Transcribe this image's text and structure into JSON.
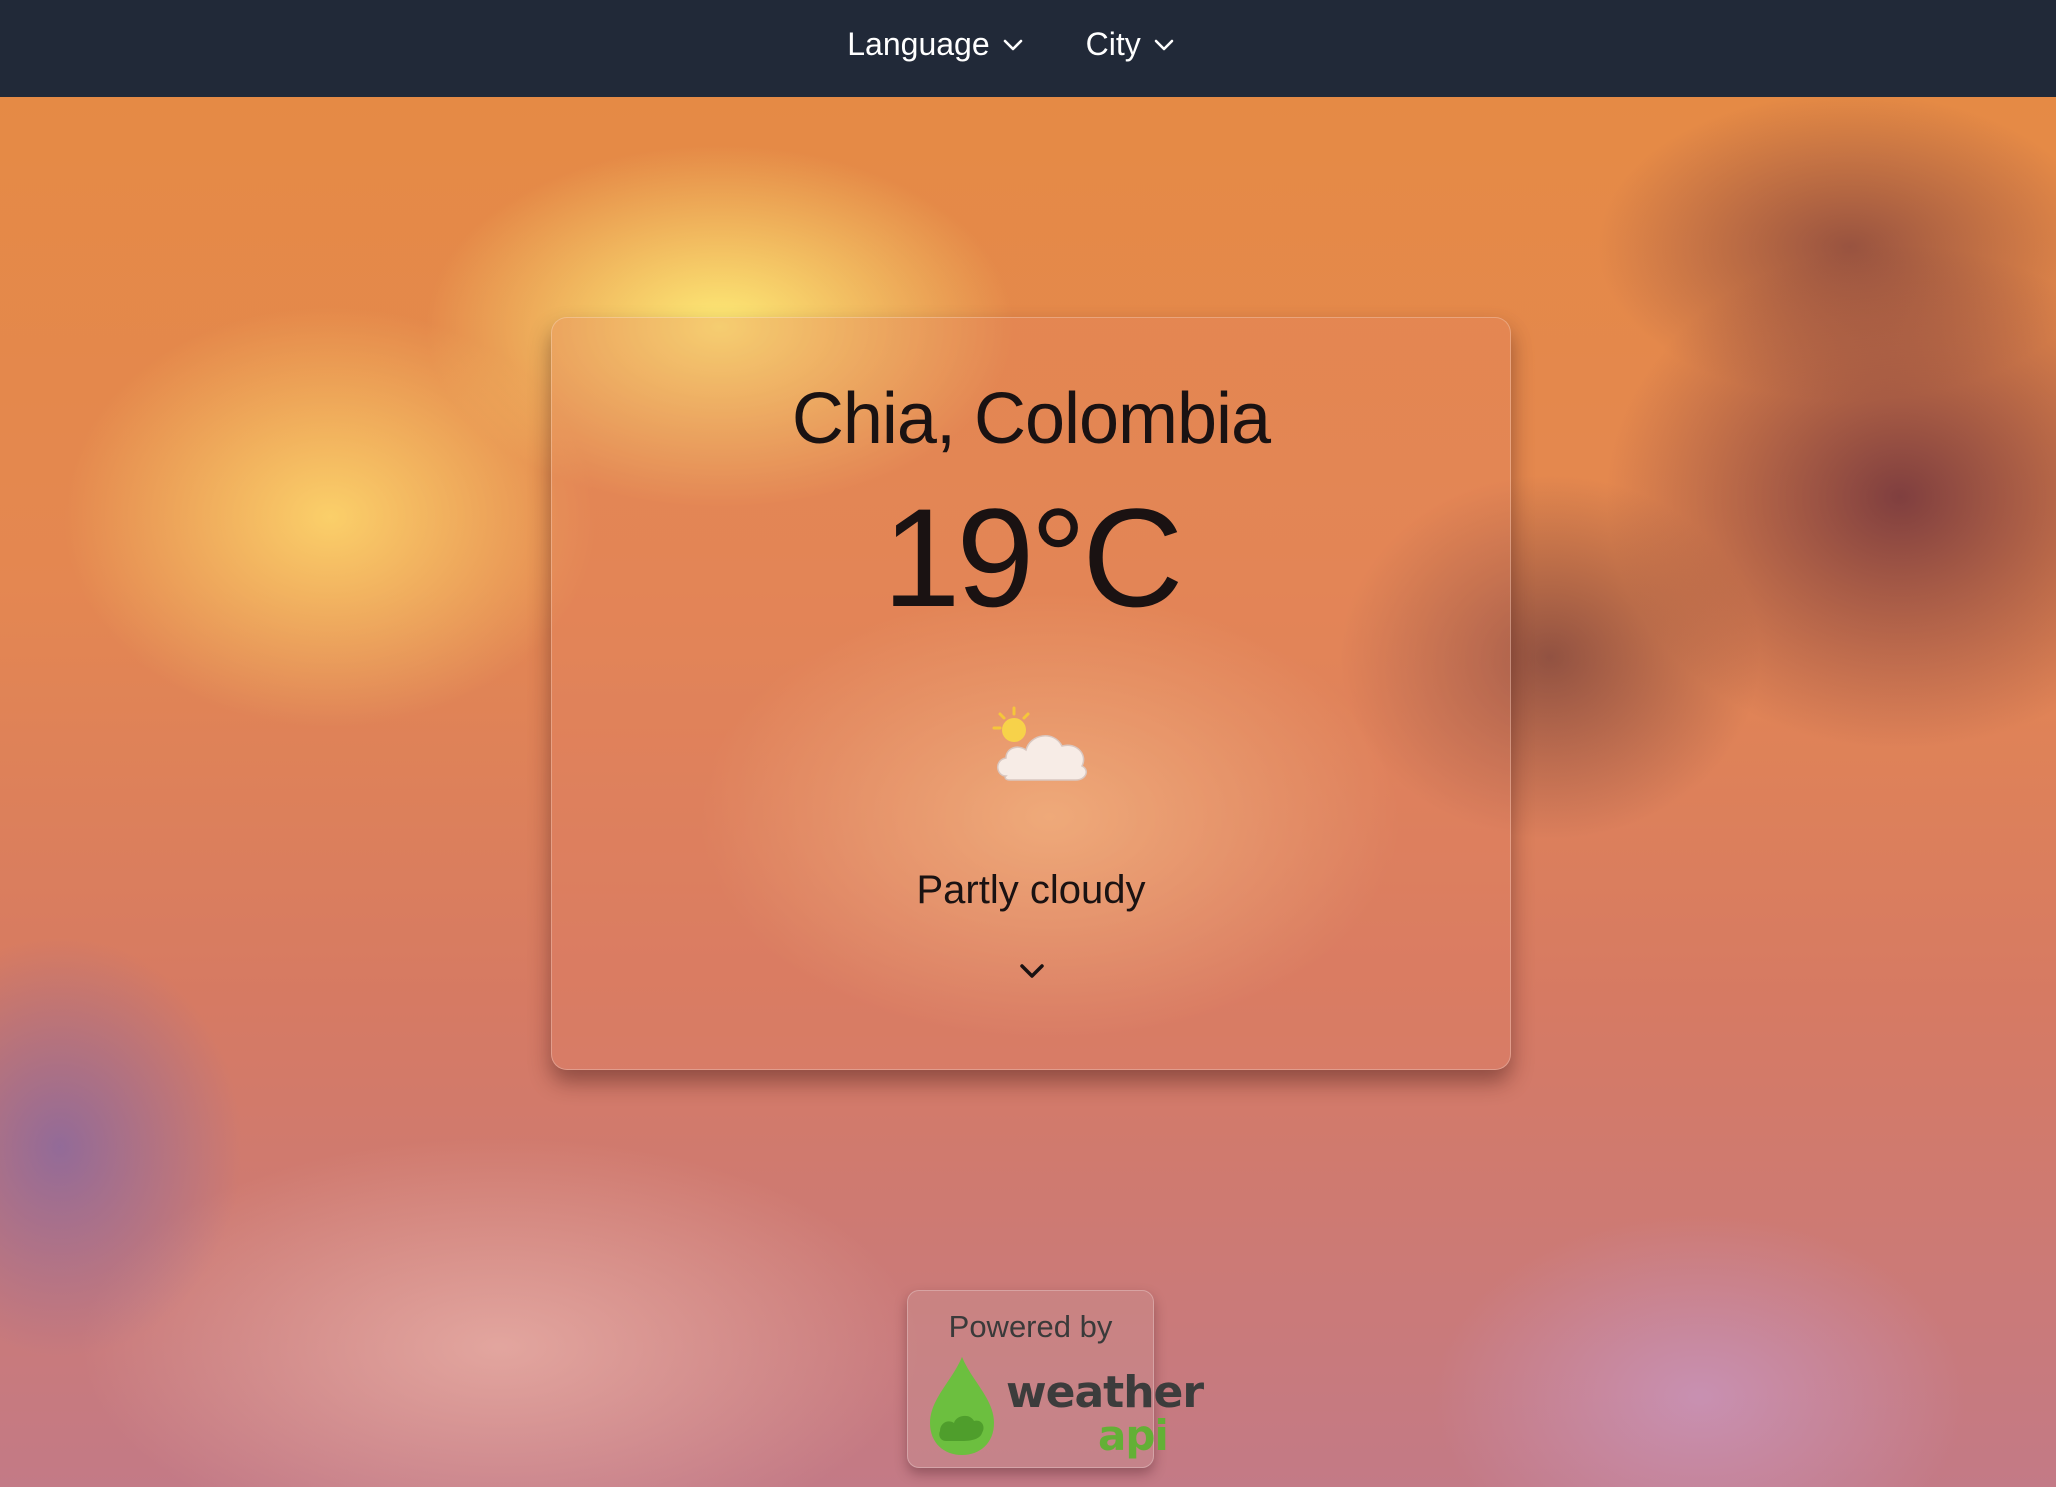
{
  "navbar": {
    "language_label": "Language",
    "city_label": "City",
    "background_color": "#212938"
  },
  "weather": {
    "location": "Chia, Colombia",
    "temperature": "19°C",
    "condition": "Partly cloudy",
    "icon": "partly-cloudy-icon"
  },
  "footer": {
    "powered_by": "Powered by",
    "logo_word_1": "weather",
    "logo_word_2": "api",
    "logo_colors": {
      "drop": "#6cbf3f",
      "text_dark": "#3c3c3c",
      "text_green": "#63b036"
    }
  }
}
